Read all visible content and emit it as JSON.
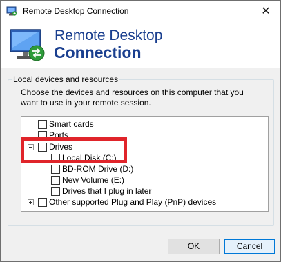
{
  "window": {
    "title": "Remote Desktop Connection",
    "close_glyph": "✕"
  },
  "banner": {
    "title_line1": "Remote Desktop",
    "title_line2": "Connection",
    "icon": "remote-desktop-icon"
  },
  "group": {
    "legend": "Local devices and resources",
    "description": "Choose the devices and resources on this computer that you want to use in your remote session."
  },
  "tree": {
    "items": [
      {
        "label": "Smart cards",
        "checked": false
      },
      {
        "label": "Ports",
        "checked": false
      },
      {
        "label": "Drives",
        "checked": false,
        "expander": "minus"
      },
      {
        "label": "Local Disk (C:)",
        "checked": false
      },
      {
        "label": "BD-ROM Drive (D:)",
        "checked": false
      },
      {
        "label": "New Volume (E:)",
        "checked": false
      },
      {
        "label": "Drives that I plug in later",
        "checked": false
      },
      {
        "label": "Other supported Plug and Play (PnP) devices",
        "checked": false,
        "expander": "plus"
      }
    ]
  },
  "buttons": {
    "ok": "OK",
    "cancel": "Cancel"
  },
  "colors": {
    "title_blue": "#1a3f8f",
    "highlight_red": "#e0242a",
    "focus_blue": "#0078d7"
  }
}
